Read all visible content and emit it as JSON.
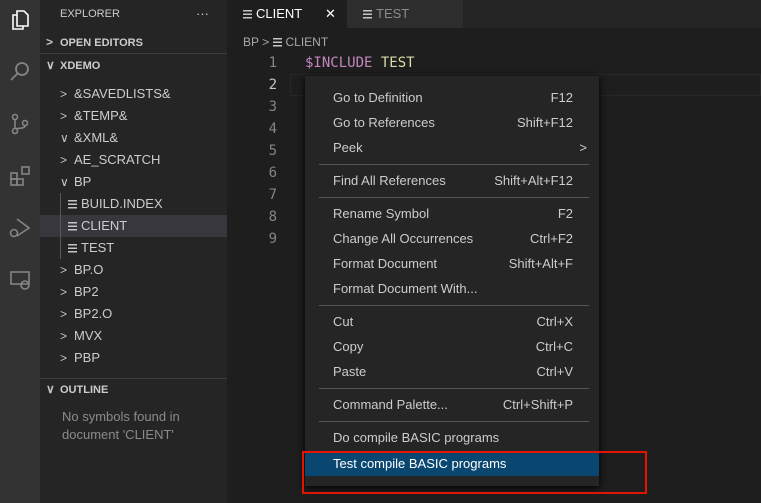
{
  "activity": [
    "explorer-icon",
    "search-icon",
    "source-control-icon",
    "extensions-icon",
    "run-debug-icon",
    "remote-explorer-icon"
  ],
  "sidebar": {
    "title": "EXPLORER",
    "more": "···",
    "open_editors": "OPEN EDITORS",
    "workspace": "XDEMO",
    "items": [
      {
        "label": "&SAVEDLISTS&",
        "type": "folder",
        "open": false
      },
      {
        "label": "&TEMP&",
        "type": "folder",
        "open": false
      },
      {
        "label": "&XML&",
        "type": "folder",
        "open": true
      },
      {
        "label": "AE_SCRATCH",
        "type": "folder",
        "open": false
      },
      {
        "label": "BP",
        "type": "folder",
        "open": true
      },
      {
        "label": "BUILD.INDEX",
        "type": "file"
      },
      {
        "label": "CLIENT",
        "type": "file",
        "selected": true
      },
      {
        "label": "TEST",
        "type": "file"
      },
      {
        "label": "BP.O",
        "type": "folder",
        "open": false
      },
      {
        "label": "BP2",
        "type": "folder",
        "open": false
      },
      {
        "label": "BP2.O",
        "type": "folder",
        "open": false
      },
      {
        "label": "MVX",
        "type": "folder",
        "open": false
      },
      {
        "label": "PBP",
        "type": "folder",
        "open": false
      }
    ],
    "outline": {
      "title": "OUTLINE",
      "message": "No symbols found in document 'CLIENT'"
    }
  },
  "tabs": [
    {
      "label": "CLIENT",
      "active": true,
      "close": "✕"
    },
    {
      "label": "TEST",
      "active": false
    }
  ],
  "breadcrumb": {
    "folder": "BP",
    "sep": ">",
    "file": "CLIENT"
  },
  "editor": {
    "line_numbers": [
      "1",
      "2",
      "3",
      "4",
      "5",
      "6",
      "7",
      "8",
      "9"
    ],
    "code": {
      "keyword": "$INCLUDE",
      "arg": "TEST"
    }
  },
  "menu": [
    {
      "label": "Go to Definition",
      "key": "F12"
    },
    {
      "label": "Go to References",
      "key": "Shift+F12"
    },
    {
      "label": "Peek",
      "key": ">"
    },
    {
      "sep": true
    },
    {
      "label": "Find All References",
      "key": "Shift+Alt+F12"
    },
    {
      "sep": true
    },
    {
      "label": "Rename Symbol",
      "key": "F2"
    },
    {
      "label": "Change All Occurrences",
      "key": "Ctrl+F2"
    },
    {
      "label": "Format Document",
      "key": "Shift+Alt+F"
    },
    {
      "label": "Format Document With...",
      "key": ""
    },
    {
      "sep": true
    },
    {
      "label": "Cut",
      "key": "Ctrl+X"
    },
    {
      "label": "Copy",
      "key": "Ctrl+C"
    },
    {
      "label": "Paste",
      "key": "Ctrl+V"
    },
    {
      "sep": true
    },
    {
      "label": "Command Palette...",
      "key": "Ctrl+Shift+P"
    },
    {
      "sep": true
    },
    {
      "label": "Do compile BASIC programs",
      "key": ""
    },
    {
      "label": "Test compile BASIC programs",
      "key": "",
      "highlighted": true
    }
  ],
  "colors": {
    "highlight": "#094771",
    "annotation": "#e51400",
    "keyword": "#c586c0",
    "arg": "#dcdcaa"
  }
}
